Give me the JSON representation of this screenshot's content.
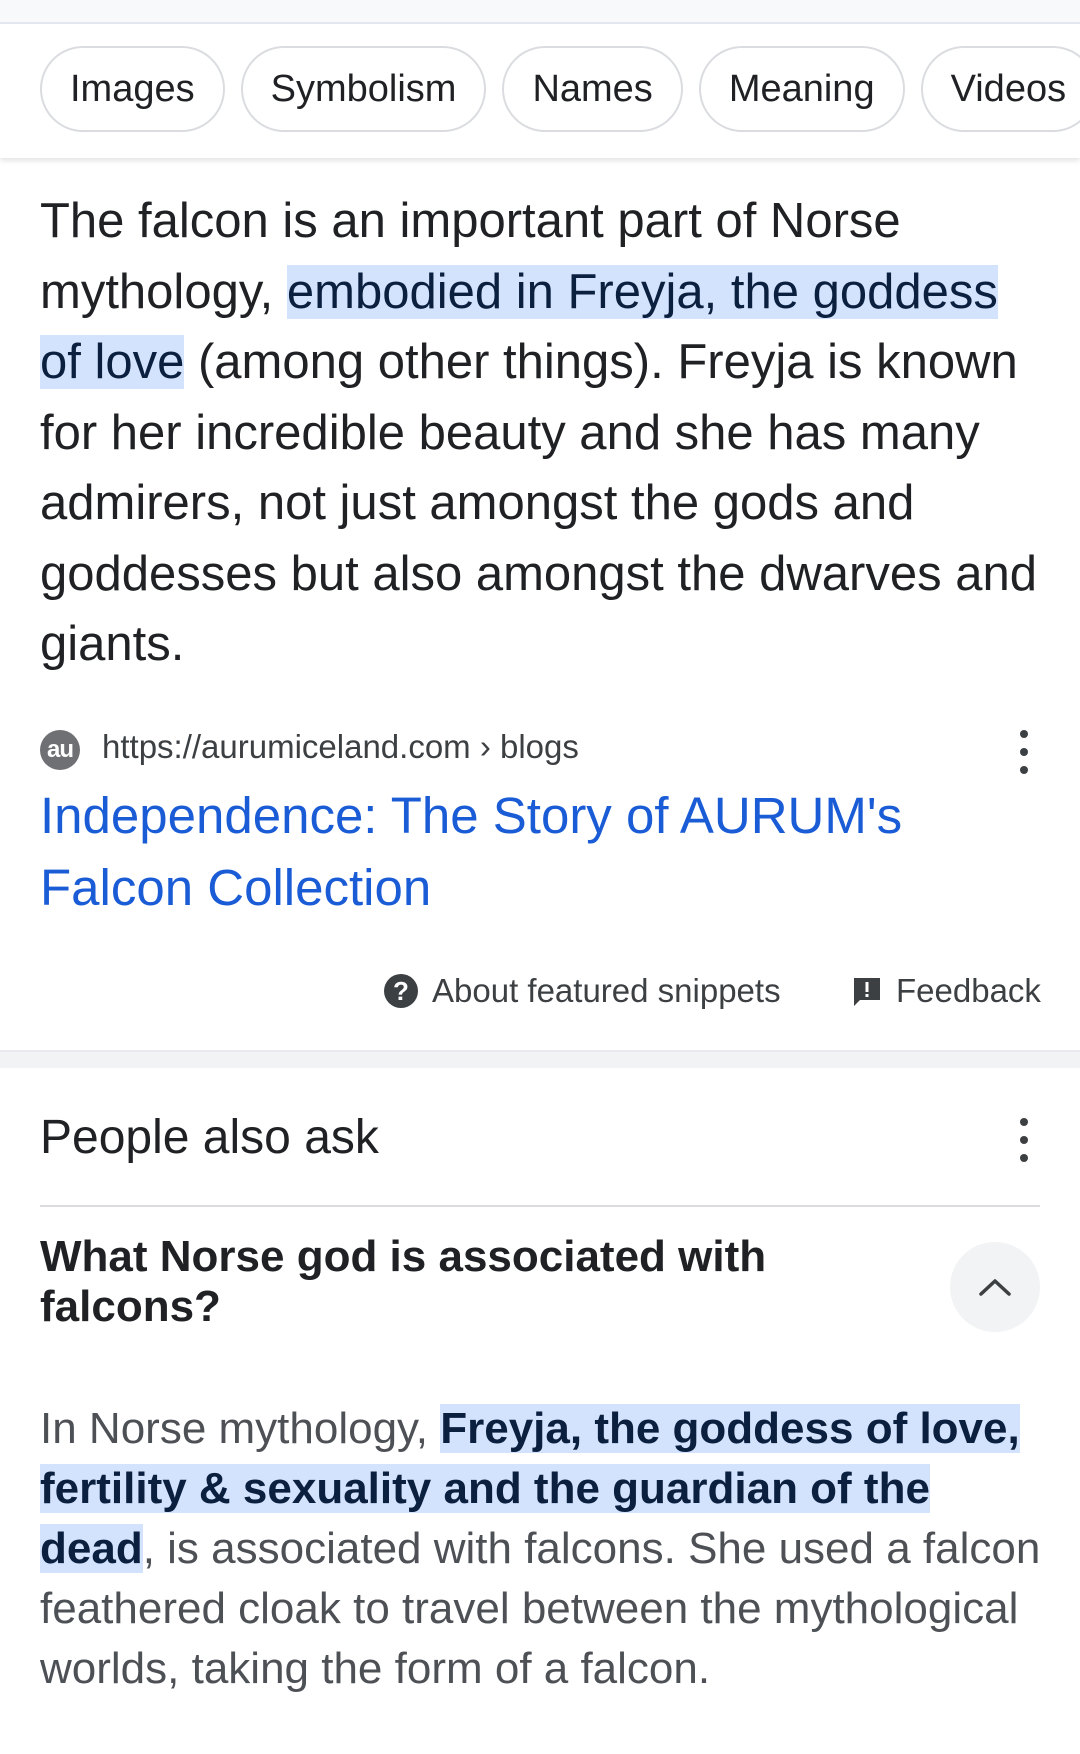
{
  "chips": [
    "Images",
    "Symbolism",
    "Names",
    "Meaning",
    "Videos"
  ],
  "snippet": {
    "before": "The falcon is an important part of Norse mythology, ",
    "highlight": "embodied in Freyja, the goddess of love",
    "after": " (among other things). Freyja is known for her incredible beauty and she has many admirers, not just amongst the gods and goddesses but also amongst the dwarves and giants."
  },
  "source": {
    "favicon_text": "au",
    "url": "https://aurumiceland.com › blogs",
    "title": "Independence: The Story of AURUM's Falcon Collection"
  },
  "footer": {
    "about_label": "About featured snippets",
    "feedback_label": "Feedback"
  },
  "people_also_ask": {
    "title": "People also ask",
    "question": "What Norse god is associated with falcons?",
    "answer_before": "In Norse mythology, ",
    "answer_highlight": "Freyja, the goddess of love, fertility & sexuality and the guardian of the dead",
    "answer_after": ", is associated with falcons. She used a falcon feathered cloak to travel between the mythological worlds, taking the form of a falcon."
  },
  "icons": [
    "help-circle-icon",
    "feedback-icon",
    "more-vert-icon",
    "chevron-up-icon"
  ],
  "colors": {
    "link": "#1a5bd6",
    "highlight": "#d3e3fd"
  }
}
